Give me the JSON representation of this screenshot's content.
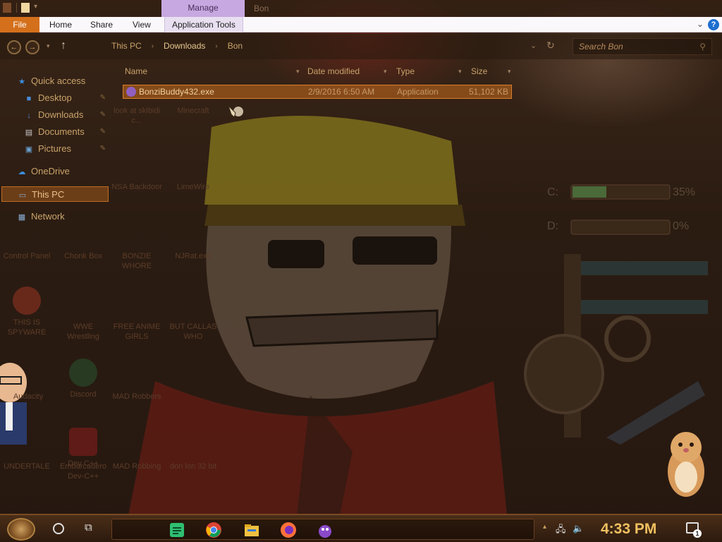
{
  "titlebar": {
    "manage_tab": "Manage",
    "window_title": "Bon"
  },
  "ribbon": {
    "file": "File",
    "tabs": [
      "Home",
      "Share",
      "View",
      "Application Tools"
    ]
  },
  "address": {
    "crumbs": [
      "This PC",
      "Downloads",
      "Bon"
    ],
    "search_placeholder": "Search Bon"
  },
  "nav": {
    "quick_access": "Quick access",
    "pinned": [
      {
        "label": "Desktop",
        "icon": "desktop-folder-icon"
      },
      {
        "label": "Downloads",
        "icon": "downloads-folder-icon"
      },
      {
        "label": "Documents",
        "icon": "documents-folder-icon"
      },
      {
        "label": "Pictures",
        "icon": "pictures-folder-icon"
      }
    ],
    "onedrive": "OneDrive",
    "this_pc": "This PC",
    "network": "Network"
  },
  "columns": {
    "name": "Name",
    "date": "Date modified",
    "type": "Type",
    "size": "Size"
  },
  "files": [
    {
      "name": "BonziBuddy432.exe",
      "date": "2/9/2016 6:50 AM",
      "type": "Application",
      "size": "51,102 KB"
    }
  ],
  "desktop_icons": [
    {
      "label": "look at skibidi c..."
    },
    {
      "label": "Minecraft"
    },
    {
      "label": "NSA Backdoor"
    },
    {
      "label": "LimeWire"
    },
    {
      "label": "BONZIE WHORE"
    },
    {
      "label": "NJRat.exe"
    },
    {
      "label": "Control Panel"
    },
    {
      "label": "Chonk Box"
    },
    {
      "label": "THIS IS SPYWARE"
    },
    {
      "label": "WWE Wrestling"
    },
    {
      "label": "FREE ANIME GIRLS"
    },
    {
      "label": "BUT CALLAS WHO"
    },
    {
      "label": "Audacity"
    },
    {
      "label": "Discord"
    },
    {
      "label": "MAD Robbers"
    },
    {
      "label": "Dev C++"
    },
    {
      "label": "UNDERTALE"
    },
    {
      "label": "Embarcadero Dev-C++"
    },
    {
      "label": "MAD Robbing"
    },
    {
      "label": "don lon 32 bit"
    }
  ],
  "gauges": [
    {
      "drive": "C:",
      "percent": "35%",
      "fill": 0.35
    },
    {
      "drive": "D:",
      "percent": "0%",
      "fill": 0.0
    }
  ],
  "taskbar": {
    "time": "4:33 PM",
    "notifications": "1",
    "apps": [
      "sticky-notes-icon",
      "chrome-icon",
      "file-explorer-icon",
      "firefox-icon",
      "bonzibuddy-icon"
    ]
  },
  "colors": {
    "accent_orange": "#d4701c",
    "manage_purple": "#c8a8e0",
    "clock_gold": "#f0c060"
  }
}
